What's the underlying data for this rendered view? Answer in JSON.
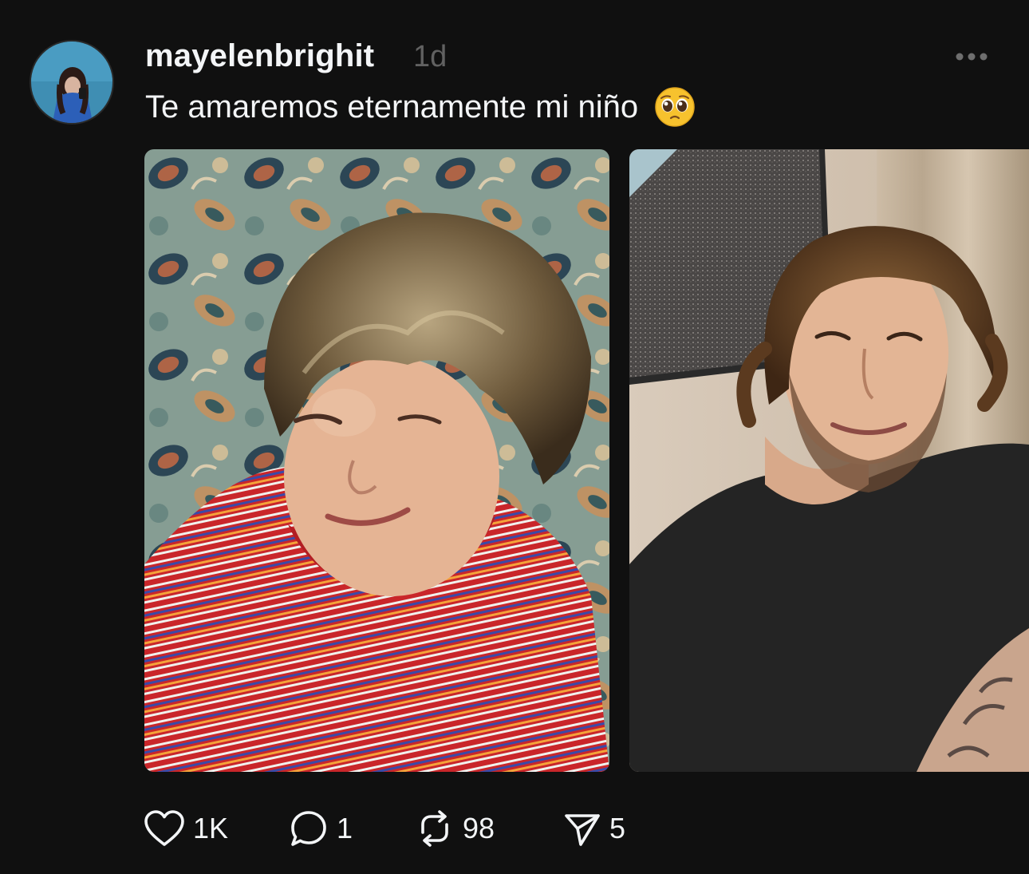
{
  "post": {
    "username": "mayelenbrighit",
    "timestamp": "1d",
    "caption": "Te amaremos eternamente mi niño",
    "caption_emoji": "pleading-face-emoji",
    "more_icon": "more-horizontal-icon",
    "images": [
      {
        "subject": "child-photo",
        "description_icon": "photo"
      },
      {
        "subject": "adult-photo",
        "description_icon": "photo"
      }
    ]
  },
  "actions": {
    "like": {
      "icon": "heart-icon",
      "count": "1K"
    },
    "reply": {
      "icon": "comment-icon",
      "count": "1"
    },
    "repost": {
      "icon": "repost-icon",
      "count": "98"
    },
    "share": {
      "icon": "send-icon",
      "count": "5"
    }
  },
  "colors": {
    "background": "#101010",
    "text_primary": "#f3f5f7",
    "text_secondary": "#616161"
  }
}
